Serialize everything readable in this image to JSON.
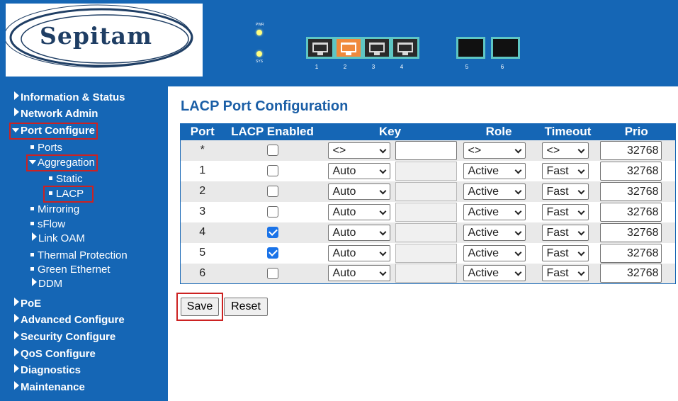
{
  "header": {
    "logo_text": "Sepitam",
    "leds": [
      {
        "label": "PWR"
      },
      {
        "label": "SYS"
      }
    ],
    "ports": [
      "1",
      "2",
      "3",
      "4",
      "5",
      "6"
    ],
    "colors": {
      "background": "#1566b5",
      "port_border": "#5ec6c4",
      "active_port": "#f08a3c"
    }
  },
  "sidebar": {
    "items": [
      {
        "label": "Information & Status",
        "icon": "triangle-right-icon"
      },
      {
        "label": "Network Admin",
        "icon": "triangle-right-icon"
      },
      {
        "label": "Port Configure",
        "icon": "triangle-down-icon"
      },
      {
        "label": "Ports",
        "icon": "square-bullet-icon"
      },
      {
        "label": "Aggregation",
        "icon": "triangle-down-icon"
      },
      {
        "label": "Static",
        "icon": "square-bullet-icon"
      },
      {
        "label": "LACP",
        "icon": "square-bullet-icon"
      },
      {
        "label": "Mirroring",
        "icon": "square-bullet-icon"
      },
      {
        "label": "sFlow",
        "icon": "square-bullet-icon"
      },
      {
        "label": "Link OAM",
        "icon": "triangle-right-icon"
      },
      {
        "label": "Thermal Protection",
        "icon": "square-bullet-icon"
      },
      {
        "label": "Green Ethernet",
        "icon": "square-bullet-icon"
      },
      {
        "label": "DDM",
        "icon": "triangle-right-icon"
      },
      {
        "label": "PoE",
        "icon": "triangle-right-icon"
      },
      {
        "label": "Advanced Configure",
        "icon": "triangle-right-icon"
      },
      {
        "label": "Security Configure",
        "icon": "triangle-right-icon"
      },
      {
        "label": "QoS Configure",
        "icon": "triangle-right-icon"
      },
      {
        "label": "Diagnostics",
        "icon": "triangle-right-icon"
      },
      {
        "label": "Maintenance",
        "icon": "triangle-right-icon"
      }
    ]
  },
  "main": {
    "title": "LACP Port Configuration",
    "columns": [
      "Port",
      "LACP Enabled",
      "Key",
      "Role",
      "Timeout",
      "Prio"
    ],
    "rows": [
      {
        "port": "*",
        "enabled": false,
        "key": "<>",
        "role": "<>",
        "timeout": "<>",
        "prio": "32768"
      },
      {
        "port": "1",
        "enabled": false,
        "key": "Auto",
        "role": "Active",
        "timeout": "Fast",
        "prio": "32768"
      },
      {
        "port": "2",
        "enabled": false,
        "key": "Auto",
        "role": "Active",
        "timeout": "Fast",
        "prio": "32768"
      },
      {
        "port": "3",
        "enabled": false,
        "key": "Auto",
        "role": "Active",
        "timeout": "Fast",
        "prio": "32768"
      },
      {
        "port": "4",
        "enabled": true,
        "key": "Auto",
        "role": "Active",
        "timeout": "Fast",
        "prio": "32768"
      },
      {
        "port": "5",
        "enabled": true,
        "key": "Auto",
        "role": "Active",
        "timeout": "Fast",
        "prio": "32768"
      },
      {
        "port": "6",
        "enabled": false,
        "key": "Auto",
        "role": "Active",
        "timeout": "Fast",
        "prio": "32768"
      }
    ],
    "save_label": "Save",
    "reset_label": "Reset",
    "colors": {
      "title": "#1a5ea6",
      "header_bg": "#1566b5",
      "row_alt": "#e9e9e9",
      "highlight": "#cc2222",
      "checkbox_checked": "#1a73e8"
    }
  }
}
